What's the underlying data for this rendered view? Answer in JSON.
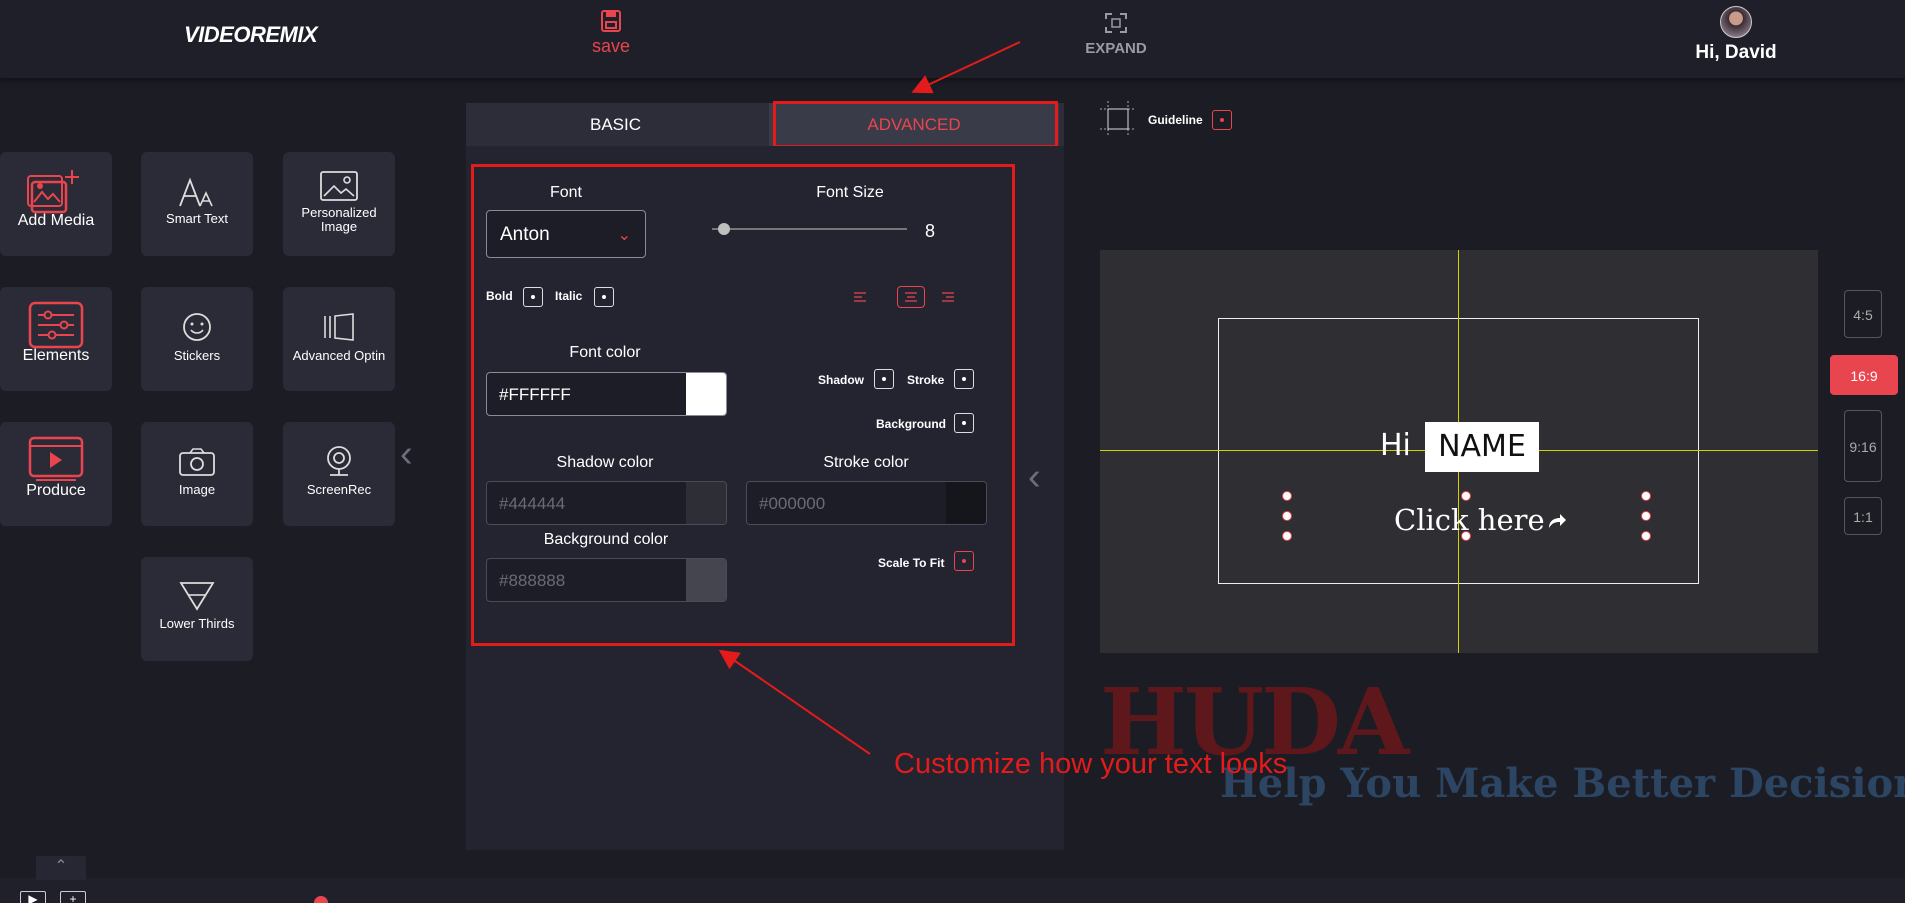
{
  "header": {
    "logo": "VIDEOREMIX",
    "save_label": "save",
    "expand_label": "EXPAND",
    "greeting": "Hi, David"
  },
  "tools": [
    {
      "label": "Add Media"
    },
    {
      "label": "Smart Text"
    },
    {
      "label": "Personalized Image"
    },
    {
      "label": "Elements"
    },
    {
      "label": "Stickers"
    },
    {
      "label": "Advanced Optin"
    },
    {
      "label": "Produce"
    },
    {
      "label": "Image"
    },
    {
      "label": "ScreenRec"
    },
    {
      "label": "Lower Thirds"
    }
  ],
  "editor": {
    "tabs": {
      "basic": "BASIC",
      "advanced": "ADVANCED"
    },
    "font_label": "Font",
    "font_value": "Anton",
    "font_size_label": "Font Size",
    "font_size_value": "8",
    "font_size_fraction": 0.06,
    "bold_label": "Bold",
    "italic_label": "Italic",
    "font_color_label": "Font color",
    "font_color_value": "#FFFFFF",
    "shadow_label": "Shadow",
    "stroke_label": "Stroke",
    "background_label": "Background",
    "shadow_color_label": "Shadow color",
    "shadow_color_value": "#444444",
    "stroke_color_label": "Stroke color",
    "stroke_color_value": "#000000",
    "background_color_label": "Background color",
    "background_color_value": "#888888",
    "scale_to_fit_label": "Scale To Fit"
  },
  "preview": {
    "guideline_label": "Guideline",
    "hi_text": "Hi",
    "name_text": "NAME",
    "click_text": "Click here",
    "ratios": [
      "4:5",
      "16:9",
      "9:16",
      "1:1"
    ],
    "active_ratio": "16:9"
  },
  "annotation_text": "Customize how your text looks",
  "watermark": {
    "title": "HUDA",
    "tagline": "Help You Make Better Decisions"
  },
  "colors": {
    "accent": "#e8454f",
    "annotation": "#e41b1b",
    "guide": "#d6d000"
  }
}
